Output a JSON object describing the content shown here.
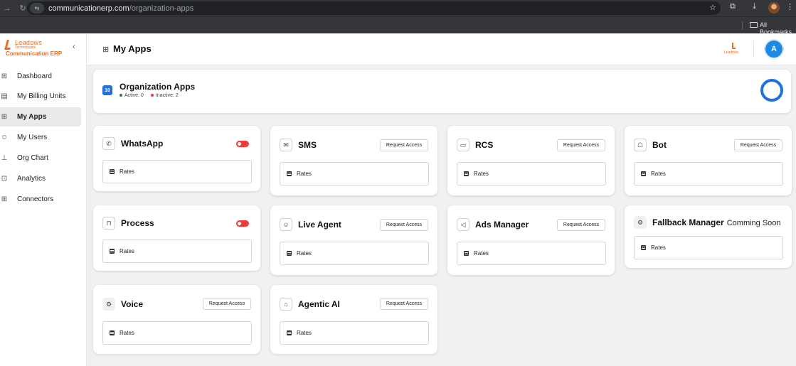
{
  "browser": {
    "url_host": "communicationerp.com",
    "url_path": "/organization-apps",
    "bookmarks_label": "All Bookmarks"
  },
  "sidebar": {
    "brand_name": "Leadows",
    "brand_sub": "Technologies",
    "brand_product": "Communication ERP",
    "items": [
      {
        "label": "Dashboard",
        "icon": "grid-icon",
        "active": false
      },
      {
        "label": "My Billing Units",
        "icon": "billing-icon",
        "active": false
      },
      {
        "label": "My Apps",
        "icon": "apps-icon",
        "active": true
      },
      {
        "label": "My Users",
        "icon": "users-icon",
        "active": false
      },
      {
        "label": "Org Chart",
        "icon": "org-chart-icon",
        "active": false
      },
      {
        "label": "Analytics",
        "icon": "analytics-icon",
        "active": false
      },
      {
        "label": "Connectors",
        "icon": "connectors-icon",
        "active": false
      }
    ]
  },
  "header": {
    "title": "My Apps",
    "logo_text": "Leadows",
    "avatar_initial": "A"
  },
  "summary": {
    "count": "10",
    "title": "Organization Apps",
    "active_text": "Active: 0",
    "inactive_text": "Inactive: 2"
  },
  "colors": {
    "brand": "#f06a1e",
    "accent": "#1e6fe0",
    "toggle_off": "#ef3b3b"
  },
  "apps": [
    {
      "name": "WhatsApp",
      "icon": "whatsapp-icon",
      "control": "toggle",
      "rates_label": "Rates"
    },
    {
      "name": "SMS",
      "icon": "sms-icon",
      "control": "button",
      "button_label": "Request Access",
      "rates_label": "Rates"
    },
    {
      "name": "RCS",
      "icon": "rcs-icon",
      "control": "button",
      "button_label": "Request Access",
      "rates_label": "Rates"
    },
    {
      "name": "Bot",
      "icon": "bot-icon",
      "control": "button",
      "button_label": "Request Access",
      "rates_label": "Rates"
    },
    {
      "name": "Process",
      "icon": "process-icon",
      "control": "toggle",
      "rates_label": "Rates"
    },
    {
      "name": "Live Agent",
      "icon": "live-agent-icon",
      "control": "button",
      "button_label": "Request Access",
      "rates_label": "Rates"
    },
    {
      "name": "Ads Manager",
      "icon": "megaphone-icon",
      "control": "button",
      "button_label": "Request Access",
      "rates_label": "Rates"
    },
    {
      "name": "Fallback Manager",
      "icon": "gear-icon",
      "control": "note",
      "note": "Comming Soon",
      "rates_label": "Rates"
    },
    {
      "name": "Voice",
      "icon": "gear-icon",
      "control": "button",
      "button_label": "Request Access",
      "rates_label": "Rates"
    },
    {
      "name": "Agentic AI",
      "icon": "agentic-ai-icon",
      "control": "button",
      "button_label": "Request Access",
      "rates_label": "Rates"
    }
  ]
}
